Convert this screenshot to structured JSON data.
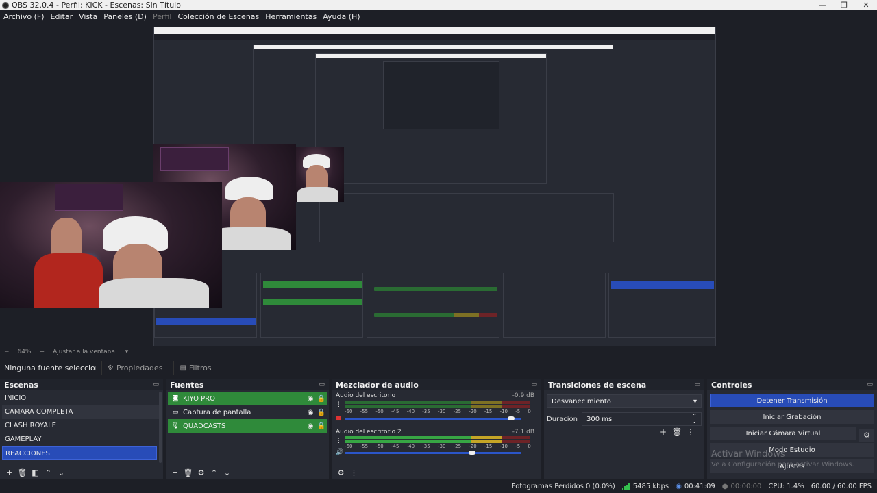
{
  "window": {
    "title": "OBS 32.0.4 - Perfil: KICK - Escenas: Sin Título",
    "minimize": "—",
    "restore": "❐",
    "close": "✕"
  },
  "menu": [
    "Archivo (F)",
    "Editar",
    "Vista",
    "Paneles (D)",
    "Perfil",
    "Colección de Escenas",
    "Herramientas",
    "Ayuda (H)"
  ],
  "zoom": {
    "minus": "−",
    "value": "64%",
    "plus": "+",
    "fit_label": "Ajustar a la ventana"
  },
  "props_bar": {
    "no_source": "Ninguna fuente seleccionada",
    "properties": "Propiedades",
    "filters": "Filtros"
  },
  "scenes": {
    "title": "Escenas",
    "items": [
      "INICIO",
      "CAMARA COMPLETA",
      "CLASH ROYALE",
      "GAMEPLAY",
      "REACCIONES"
    ],
    "selected": "REACCIONES"
  },
  "sources": {
    "title": "Fuentes",
    "items": [
      {
        "label": "KIYO PRO",
        "icon": "camera-icon"
      },
      {
        "label": "Captura de pantalla",
        "icon": "monitor-icon"
      },
      {
        "label": "QUADCASTS",
        "icon": "microphone-icon"
      }
    ]
  },
  "mixer": {
    "title": "Mezclador de audio",
    "tracks": [
      {
        "name": "Audio del escritorio",
        "db": "-0.9 dB",
        "level": 0.0,
        "volume": 0.96
      },
      {
        "name": "Audio del escritorio 2",
        "db": "-7.1 dB",
        "level": 0.86,
        "volume": 0.74
      }
    ],
    "scale": [
      "-60",
      "-55",
      "-50",
      "-45",
      "-40",
      "-35",
      "-30",
      "-25",
      "-20",
      "-15",
      "-10",
      "-5",
      "0"
    ]
  },
  "transitions": {
    "title": "Transiciones de escena",
    "selected": "Desvanecimiento",
    "duration_label": "Duración",
    "duration_value": "300 ms"
  },
  "controls": {
    "title": "Controles",
    "buttons": [
      "Detener Transmisión",
      "Iniciar Grabación",
      "Iniciar Cámara Virtual",
      "Modo Estudio",
      "Ajustes"
    ],
    "watermark_title": "Activar Windows",
    "watermark_sub": "Ve a Configuración para activar Windows."
  },
  "status": {
    "dropped": "Fotogramas Perdidos 0 (0.0%)",
    "bitrate": "5485 kbps",
    "stream_time": "00:41:09",
    "rec_time": "00:00:00",
    "cpu": "CPU: 1.4%",
    "fps": "60.00 / 60.00 FPS"
  },
  "colors": {
    "accent": "#284cb8",
    "source_green": "#2f8a3a",
    "background": "#1d1f26",
    "panel": "#272a33"
  }
}
